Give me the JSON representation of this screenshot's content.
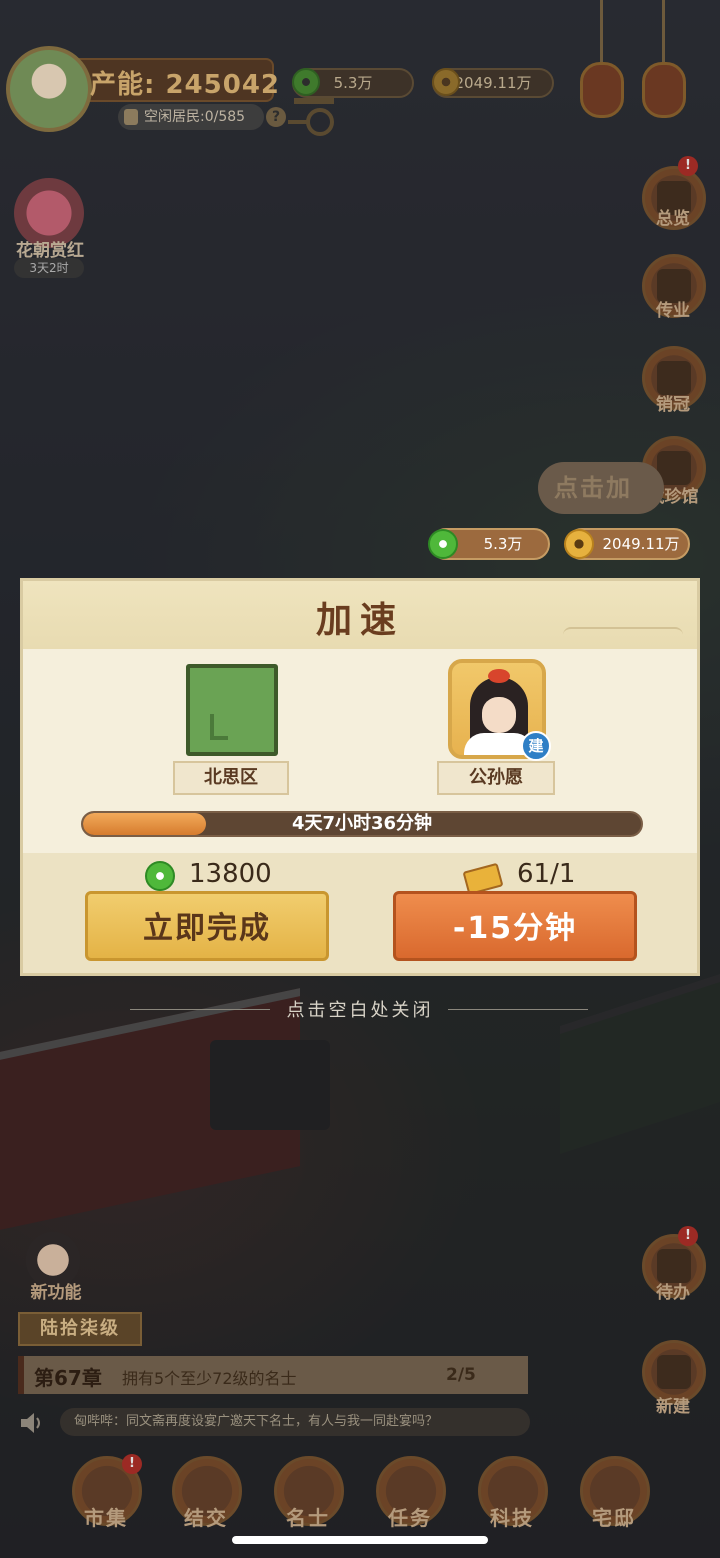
{
  "hud": {
    "production": "产能: 245042",
    "idle_residents": "空闲居民:0/585",
    "help": "?",
    "jade_amount": "5.3万",
    "coin_amount": "2049.11万"
  },
  "event": {
    "label": "花朝赏红",
    "time": "3天2时"
  },
  "side_menu": {
    "overview": "总览",
    "inherit": "传业",
    "sales": "销冠",
    "museum": "藏珍馆",
    "todo": "待办",
    "build": "新建",
    "badge": "!"
  },
  "hint_bubble": "点击加",
  "resources_bright": {
    "jade": "5.3万",
    "coin": "2049.11万"
  },
  "dialog": {
    "title": "加速",
    "building_name": "北思区",
    "character_name": "公孙愿",
    "character_tag": "建",
    "progress_fraction": 0.22,
    "time_left": "4天7小时36分钟",
    "jade_cost": "13800",
    "ticket_count": "61/1",
    "complete_button": "立即完成",
    "speedup_button": "-15分钟"
  },
  "close_hint": "点击空白处关闭",
  "new_feature": "新功能",
  "level_tag": "陆拾柒级",
  "chapter": {
    "number": "第67章",
    "desc": "拥有5个至少72级的名士",
    "progress": "2/5"
  },
  "broadcast": "匈哔哔：同文斋再度设宴广邀天下名士，有人与我一同赴宴吗？",
  "tabs": [
    "市集",
    "结交",
    "名士",
    "任务",
    "科技",
    "宅邸"
  ]
}
